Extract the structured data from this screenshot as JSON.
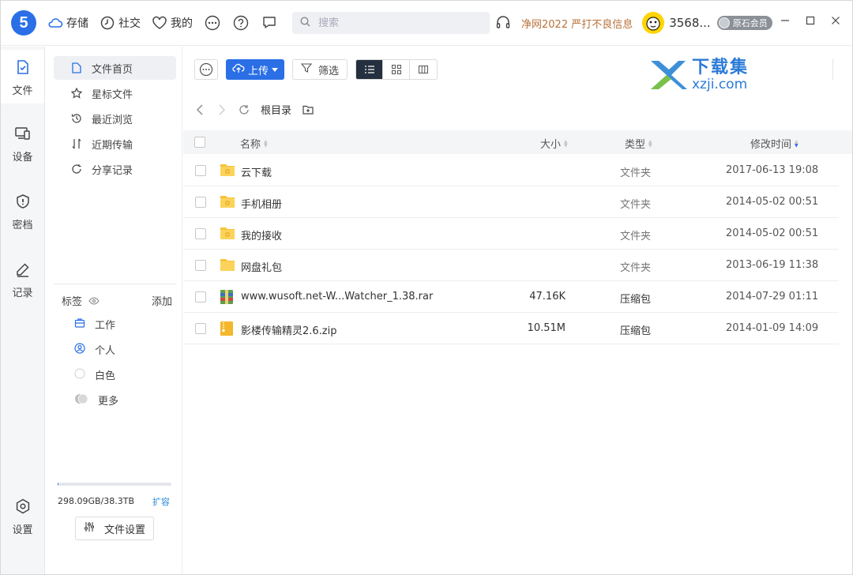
{
  "app": {
    "logo_text": "5",
    "nav": [
      {
        "label": "存储",
        "icon": "cloud-icon"
      },
      {
        "label": "社交",
        "icon": "clock-icon"
      },
      {
        "label": "我的",
        "icon": "heart-icon"
      }
    ],
    "search_placeholder": "搜索",
    "notice": "净网2022 严打不良信息",
    "username": "3568...",
    "vip_label": "原石会员"
  },
  "rail": [
    {
      "label": "文件",
      "icon": "file-icon",
      "active": true
    },
    {
      "label": "设备",
      "icon": "device-icon"
    },
    {
      "label": "密档",
      "icon": "shield-icon"
    },
    {
      "label": "记录",
      "icon": "edit-icon"
    },
    {
      "label": "设置",
      "icon": "gear-icon"
    }
  ],
  "sidebar": {
    "items": [
      {
        "label": "文件首页",
        "icon": "file-icon",
        "active": true
      },
      {
        "label": "星标文件",
        "icon": "star-icon"
      },
      {
        "label": "最近浏览",
        "icon": "history-icon"
      },
      {
        "label": "近期传输",
        "icon": "transfer-icon"
      },
      {
        "label": "分享记录",
        "icon": "share-icon"
      }
    ],
    "tags_title": "标签",
    "tags_add": "添加",
    "tags": [
      {
        "label": "工作",
        "icon": "briefcase-icon"
      },
      {
        "label": "个人",
        "icon": "person-icon"
      },
      {
        "label": "白色",
        "icon": "white-circle-icon"
      },
      {
        "label": "更多",
        "icon": "more-tags-icon"
      }
    ],
    "storage_used_fraction": 0.0076,
    "storage_text": "298.09GB/38.3TB",
    "expand_label": "扩容",
    "settings_label": "文件设置"
  },
  "toolbar": {
    "upload_label": "上传",
    "filter_label": "筛选"
  },
  "watermark": {
    "cn": "下载集",
    "en": "xzji.com"
  },
  "path": {
    "current": "根目录"
  },
  "table": {
    "headers": {
      "name": "名称",
      "size": "大小",
      "type": "类型",
      "modified": "修改时间"
    },
    "rows": [
      {
        "name": "云下载",
        "size": "",
        "type": "文件夹",
        "modified": "2017-06-13 19:08",
        "kind": "folder"
      },
      {
        "name": "手机相册",
        "size": "",
        "type": "文件夹",
        "modified": "2014-05-02 00:51",
        "kind": "folder"
      },
      {
        "name": "我的接收",
        "size": "",
        "type": "文件夹",
        "modified": "2014-05-02 00:51",
        "kind": "folder"
      },
      {
        "name": "网盘礼包",
        "size": "",
        "type": "文件夹",
        "modified": "2013-06-19 11:38",
        "kind": "folder-plain"
      },
      {
        "name": "www.wusoft.net-W...Watcher_1.38.rar",
        "size": "47.16K",
        "type": "压缩包",
        "modified": "2014-07-29 01:11",
        "kind": "rar"
      },
      {
        "name": "影楼传输精灵2.6.zip",
        "size": "10.51M",
        "type": "压缩包",
        "modified": "2014-01-09 14:09",
        "kind": "zip"
      }
    ]
  }
}
